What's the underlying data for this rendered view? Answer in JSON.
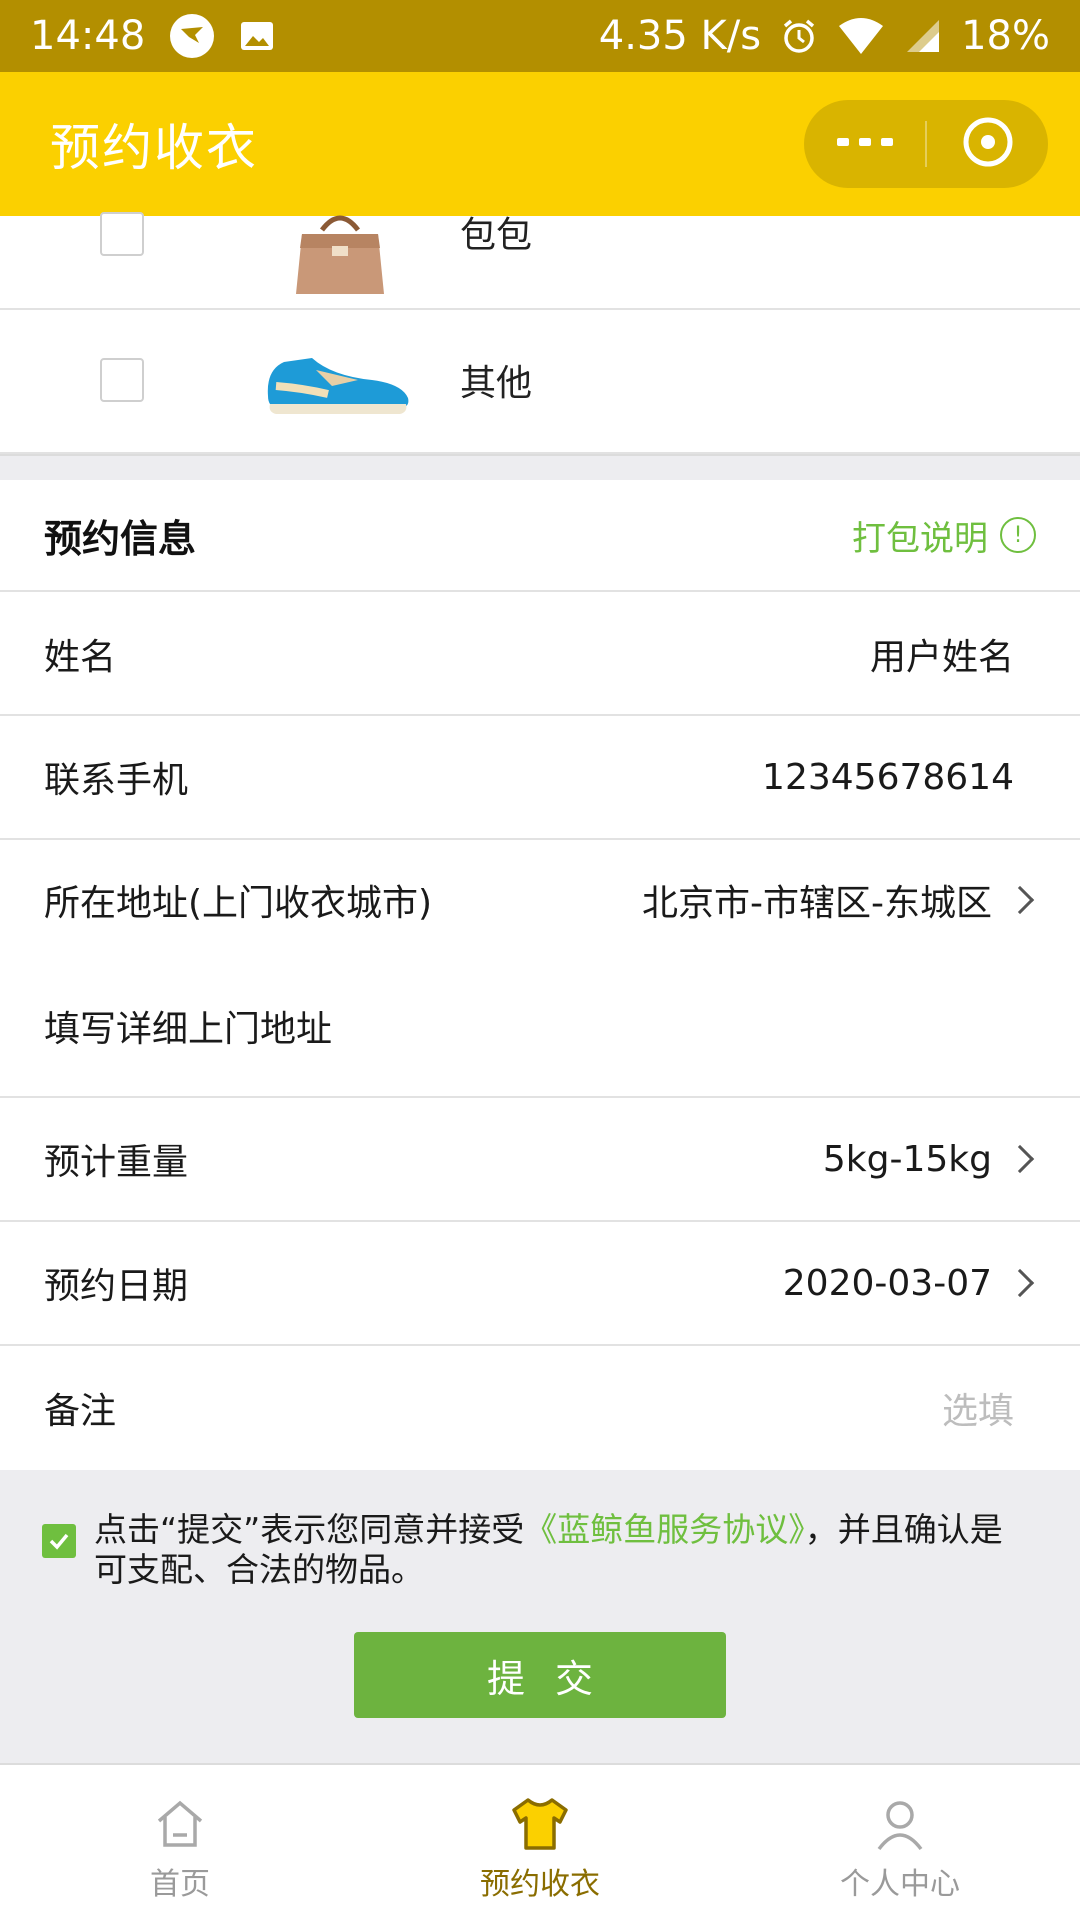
{
  "status_bar": {
    "time": "14:48",
    "speed": "4.35 K/s",
    "battery": "18%"
  },
  "header": {
    "title": "预约收衣"
  },
  "categories": [
    {
      "label": "包包",
      "icon": "handbag-image"
    },
    {
      "label": "其他",
      "icon": "sneaker-image"
    }
  ],
  "form": {
    "section_title": "预约信息",
    "pack_link": "打包说明",
    "name": {
      "label": "姓名",
      "value": "用户姓名"
    },
    "phone": {
      "label": "联系手机",
      "value": "12345678614"
    },
    "address": {
      "label": "所在地址(上门收衣城市)",
      "value": "北京市-市辖区-东城区"
    },
    "detail_address": {
      "placeholder": "填写详细上门地址"
    },
    "weight": {
      "label": "预计重量",
      "value": "5kg-15kg"
    },
    "date": {
      "label": "预约日期",
      "value": "2020-03-07"
    },
    "note": {
      "label": "备注",
      "placeholder": "选填"
    }
  },
  "agreement": {
    "prefix": "点击“提交”表示您同意并接受",
    "link": "《蓝鲸鱼服务协议》",
    "suffix": "，并且确认是可支配、合法的物品。",
    "checked": true
  },
  "submit_label": "提交",
  "tabs": [
    {
      "label": "首页",
      "icon": "home-icon",
      "active": false
    },
    {
      "label": "预约收衣",
      "icon": "shirt-icon",
      "active": true
    },
    {
      "label": "个人中心",
      "icon": "user-icon",
      "active": false
    }
  ],
  "colors": {
    "accent": "#fbd000",
    "status_bar": "#b38f00",
    "green": "#6db33f"
  }
}
